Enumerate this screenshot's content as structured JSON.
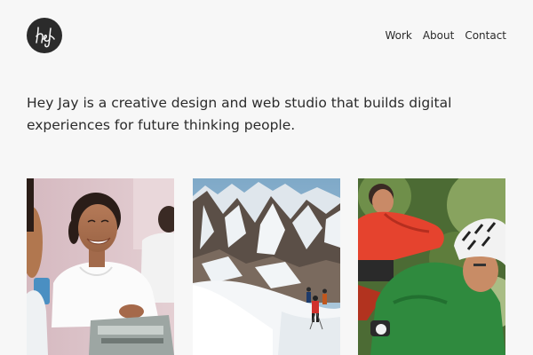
{
  "brand": {
    "logo_icon": "hey-jay-monogram-icon",
    "logo_color": "#2b2b2b"
  },
  "nav": {
    "items": [
      {
        "label": "Work"
      },
      {
        "label": "About"
      },
      {
        "label": "Contact"
      }
    ]
  },
  "intro": {
    "text": "Hey Jay is a creative design and web studio that builds digital experiences for future thinking people."
  },
  "portfolio": {
    "tiles": [
      {
        "icon": "smiling-student-photo"
      },
      {
        "icon": "mountain-climbers-photo"
      },
      {
        "icon": "mountain-bikers-photo"
      }
    ]
  }
}
